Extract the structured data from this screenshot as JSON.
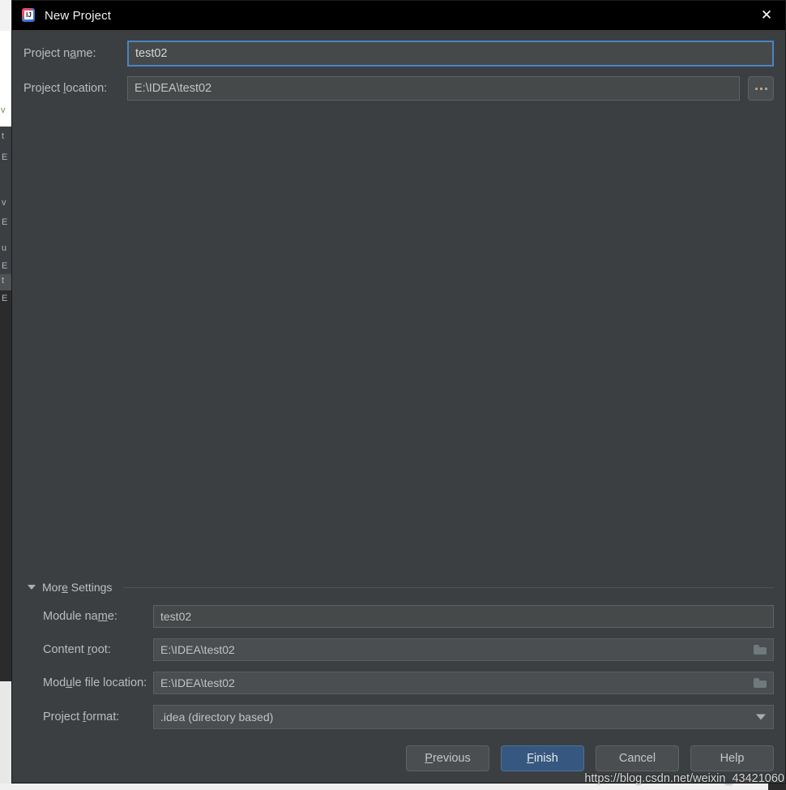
{
  "window": {
    "title": "New Project",
    "app_icon": "intellij-idea-icon",
    "icon_letters": "IJ",
    "close_icon": "close-icon"
  },
  "form": {
    "project_name": {
      "label_before": "Project n",
      "label_mnemonic": "a",
      "label_after": "me:",
      "value": "test02"
    },
    "project_location": {
      "label_before": "Project ",
      "label_mnemonic": "l",
      "label_after": "ocation:",
      "value": "E:\\IDEA\\test02"
    },
    "browse_button": {
      "label": "...",
      "icon": "ellipsis-icon"
    }
  },
  "more_settings": {
    "label_before": "Mor",
    "label_mnemonic": "e",
    "label_after": " Settings",
    "expanded": true,
    "caret_icon": "chevron-down-icon",
    "rows": [
      {
        "label_before": "Module na",
        "label_mnemonic": "m",
        "label_after": "e:",
        "value": "test02",
        "icon": null
      },
      {
        "label_before": "Content ",
        "label_mnemonic": "r",
        "label_after": "oot:",
        "value": "E:\\IDEA\\test02",
        "icon": "folder-icon"
      },
      {
        "label_before": "Mod",
        "label_mnemonic": "u",
        "label_after": "le file location:",
        "value": "E:\\IDEA\\test02",
        "icon": "folder-icon"
      }
    ],
    "project_format": {
      "label_before": "Project ",
      "label_mnemonic": "f",
      "label_after": "ormat:",
      "value": ".idea (directory based)",
      "icon": "chevron-down-icon"
    }
  },
  "buttons": {
    "previous": {
      "before": "",
      "mnemonic": "P",
      "after": "revious"
    },
    "finish": {
      "before": "",
      "mnemonic": "F",
      "after": "inish",
      "primary": true
    },
    "cancel": {
      "before": "Cancel",
      "mnemonic": "",
      "after": ""
    },
    "help": {
      "before": "Help",
      "mnemonic": "",
      "after": ""
    }
  },
  "watermark": "https://blog.csdn.net/weixin_43421060",
  "colors": {
    "dialog_bg": "#3c3f41",
    "titlebar_bg": "#000000",
    "field_bg": "#45494a",
    "focus_border": "#4b83c4",
    "primary_button": "#365880",
    "label_text": "#bbbbbb"
  }
}
